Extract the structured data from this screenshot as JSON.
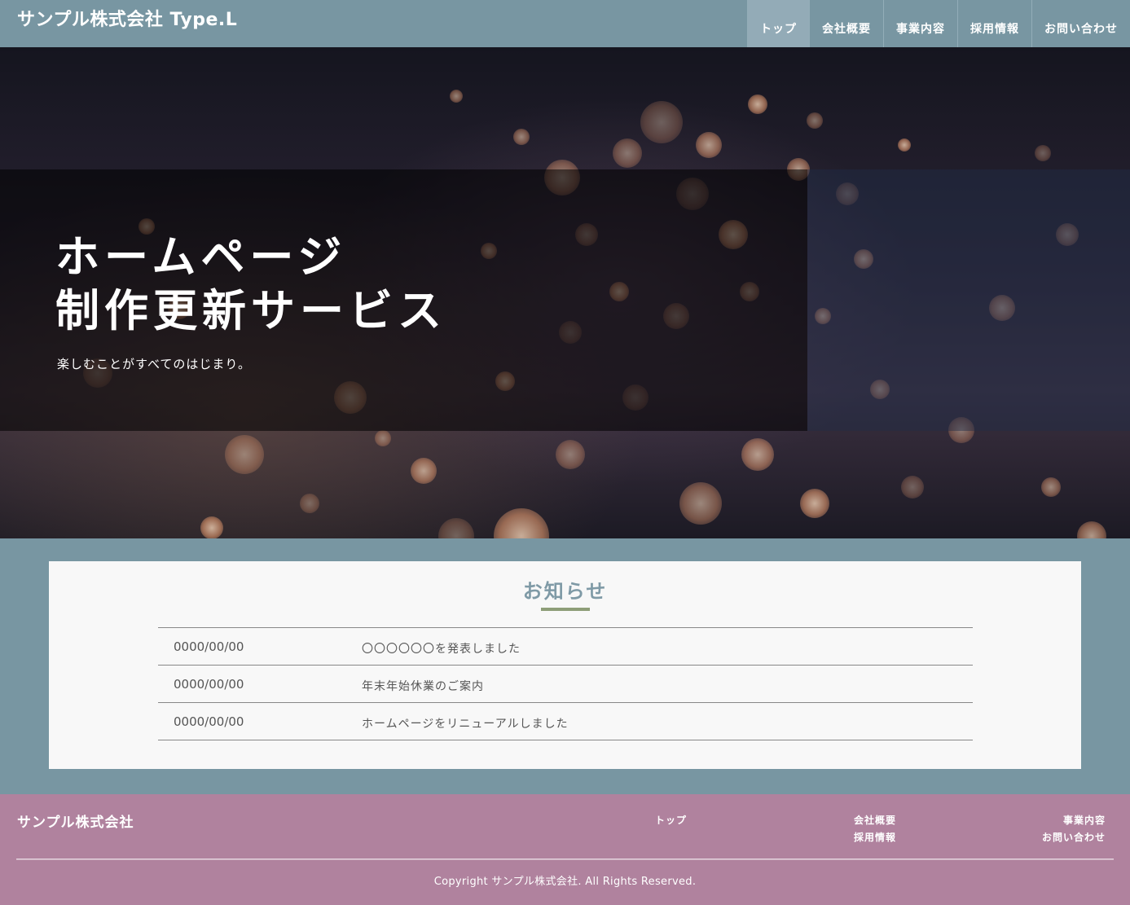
{
  "header": {
    "logo": "サンプル株式会社 Type.L",
    "nav": [
      {
        "label": "トップ"
      },
      {
        "label": "会社概要"
      },
      {
        "label": "事業内容"
      },
      {
        "label": "採用情報"
      },
      {
        "label": "お問い合わせ"
      }
    ]
  },
  "hero": {
    "title_line1": "ホームページ",
    "title_line2": "制作更新サービス",
    "subtitle": "楽しむことがすべてのはじまり。"
  },
  "news": {
    "title": "お知らせ",
    "items": [
      {
        "date": "0000/00/00",
        "text": "〇〇〇〇〇〇を発表しました"
      },
      {
        "date": "0000/00/00",
        "text": "年末年始休業のご案内"
      },
      {
        "date": "0000/00/00",
        "text": "ホームページをリニューアルしました"
      }
    ]
  },
  "footer": {
    "logo": "サンプル株式会社",
    "links": {
      "top": "トップ",
      "about": "会社概要",
      "recruit": "採用情報",
      "business": "事業内容",
      "contact": "お問い合わせ"
    },
    "copyright": "Copyright サンプル株式会社. All Rights Reserved."
  },
  "colors": {
    "header_bg": "#7896a2",
    "accent": "#8e9e78",
    "footer_bg": "#b0829e"
  }
}
